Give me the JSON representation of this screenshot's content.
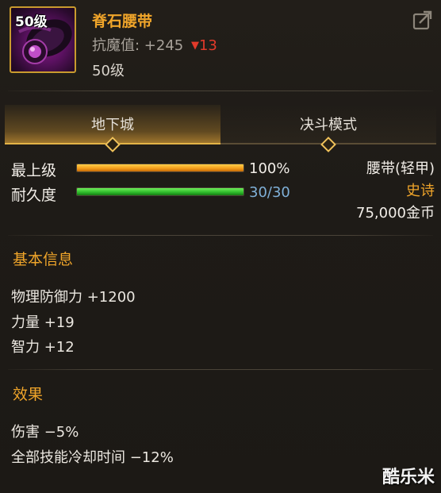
{
  "item": {
    "icon_level": "50级",
    "name": "脊石腰带",
    "resist_label": "抗魔值: +245",
    "resist_change": "13",
    "level_text": "50级"
  },
  "tabs": [
    {
      "label": "地下城",
      "active": true
    },
    {
      "label": "决斗模式",
      "active": false
    }
  ],
  "stats": {
    "top_label": "最上级",
    "top_value": "100%",
    "top_fraction": 1.0,
    "durability_label": "耐久度",
    "durability_value": "30/30",
    "durability_fraction": 1.0
  },
  "side": {
    "type": "腰带(轻甲)",
    "rarity": "史诗",
    "price": "75,000金币"
  },
  "basic_info": {
    "title": "基本信息",
    "lines": [
      "物理防御力 +1200",
      "力量 +19",
      "智力 +12"
    ]
  },
  "effects": {
    "title": "效果",
    "lines": [
      "伤害 −5%",
      "全部技能冷却时间 −12%"
    ]
  },
  "watermark": "酷乐米",
  "colors": {
    "name": "#f0a52a",
    "resist_down": "#e23a2a",
    "rarity": "#f0a52a",
    "durability_value": "#7fb0d8",
    "top_value": "#f2eee8"
  },
  "icons": {
    "share": "share-icon",
    "item": "belt-item-icon"
  }
}
